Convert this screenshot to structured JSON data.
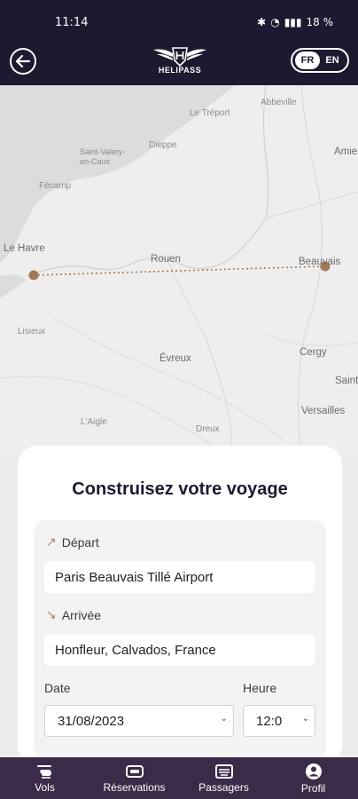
{
  "status": {
    "time": "11:14",
    "battery": "18 %"
  },
  "header": {
    "logo_text": "HELIPASS",
    "lang_fr": "FR",
    "lang_en": "EN"
  },
  "map": {
    "cities": [
      "Le Tréport",
      "Abbeville",
      "Dieppe",
      "Saint-Valery-en-Caux",
      "Fécamp",
      "Le Havre",
      "Rouen",
      "Beauvais",
      "Lisieux",
      "Évreux",
      "Cergy",
      "Versailles",
      "L'Aigle",
      "Dreux",
      "Amiens",
      "Saint-"
    ],
    "route_color": "#a07a55"
  },
  "card": {
    "title": "Construisez votre voyage",
    "depart_label": "Départ",
    "depart_value": "Paris Beauvais Tillé Airport",
    "arrival_label": "Arrivée",
    "arrival_value": "Honfleur, Calvados, France",
    "date_label": "Date",
    "date_value": "31/08/2023",
    "time_label": "Heure",
    "time_value": "12:0"
  },
  "nav": [
    {
      "label": "Vols",
      "icon": "helicopter-icon"
    },
    {
      "label": "Réservations",
      "icon": "ticket-icon"
    },
    {
      "label": "Passagers",
      "icon": "id-card-icon"
    },
    {
      "label": "Profil",
      "icon": "user-icon"
    }
  ],
  "colors": {
    "primary": "#1d1930",
    "nav_bg": "#3b2b48",
    "accent": "#b0835a"
  }
}
